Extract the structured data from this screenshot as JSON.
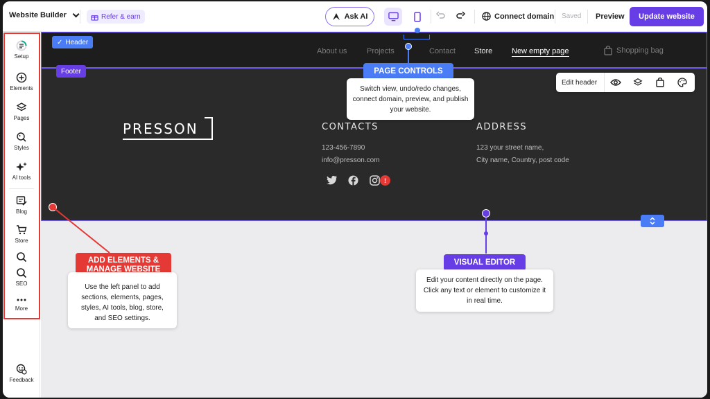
{
  "topbar": {
    "brand": "Website Builder",
    "refer": "Refer & earn",
    "ask_ai": "Ask AI",
    "connect_domain": "Connect domain",
    "saved": "Saved",
    "preview": "Preview",
    "update": "Update website"
  },
  "sidebar": {
    "items": [
      {
        "label": "Setup"
      },
      {
        "label": "Elements"
      },
      {
        "label": "Pages"
      },
      {
        "label": "Styles"
      },
      {
        "label": "AI tools"
      },
      {
        "label": "Blog"
      },
      {
        "label": "Store"
      },
      {
        "label": "SEO"
      },
      {
        "label": "More"
      }
    ],
    "feedback": "Feedback"
  },
  "canvas": {
    "header_tag": "Header",
    "footer_tag": "Footer",
    "nav": [
      "About us",
      "Projects",
      "Contact",
      "Store",
      "New empty page"
    ],
    "shopping_bag": "Shopping bag",
    "edit_header": "Edit header",
    "logo": "PRESSON",
    "contacts_title": "CONTACTS",
    "phone": "123-456-7890",
    "email": "info@presson.com",
    "address_title": "ADDRESS",
    "address_line1": "123 your street name,",
    "address_line2": "City name, Country, post code",
    "alert_badge": "!"
  },
  "callouts": {
    "page_controls": {
      "title": "PAGE CONTROLS",
      "body": "Switch view, undo/redo changes, connect domain, preview, and publish your website."
    },
    "add_elements": {
      "title": "ADD ELEMENTS & MANAGE WEBSITE",
      "body": "Use the left panel to add sections, elements, pages, styles, AI tools, blog, store, and SEO settings."
    },
    "visual_editor": {
      "title": "VISUAL EDITOR",
      "body": "Edit your content directly on the page. Click any text or element to customize it in real time."
    }
  },
  "colors": {
    "accent": "#673de6",
    "highlight_blue": "#4a7cf6",
    "highlight_red": "#e53935"
  }
}
